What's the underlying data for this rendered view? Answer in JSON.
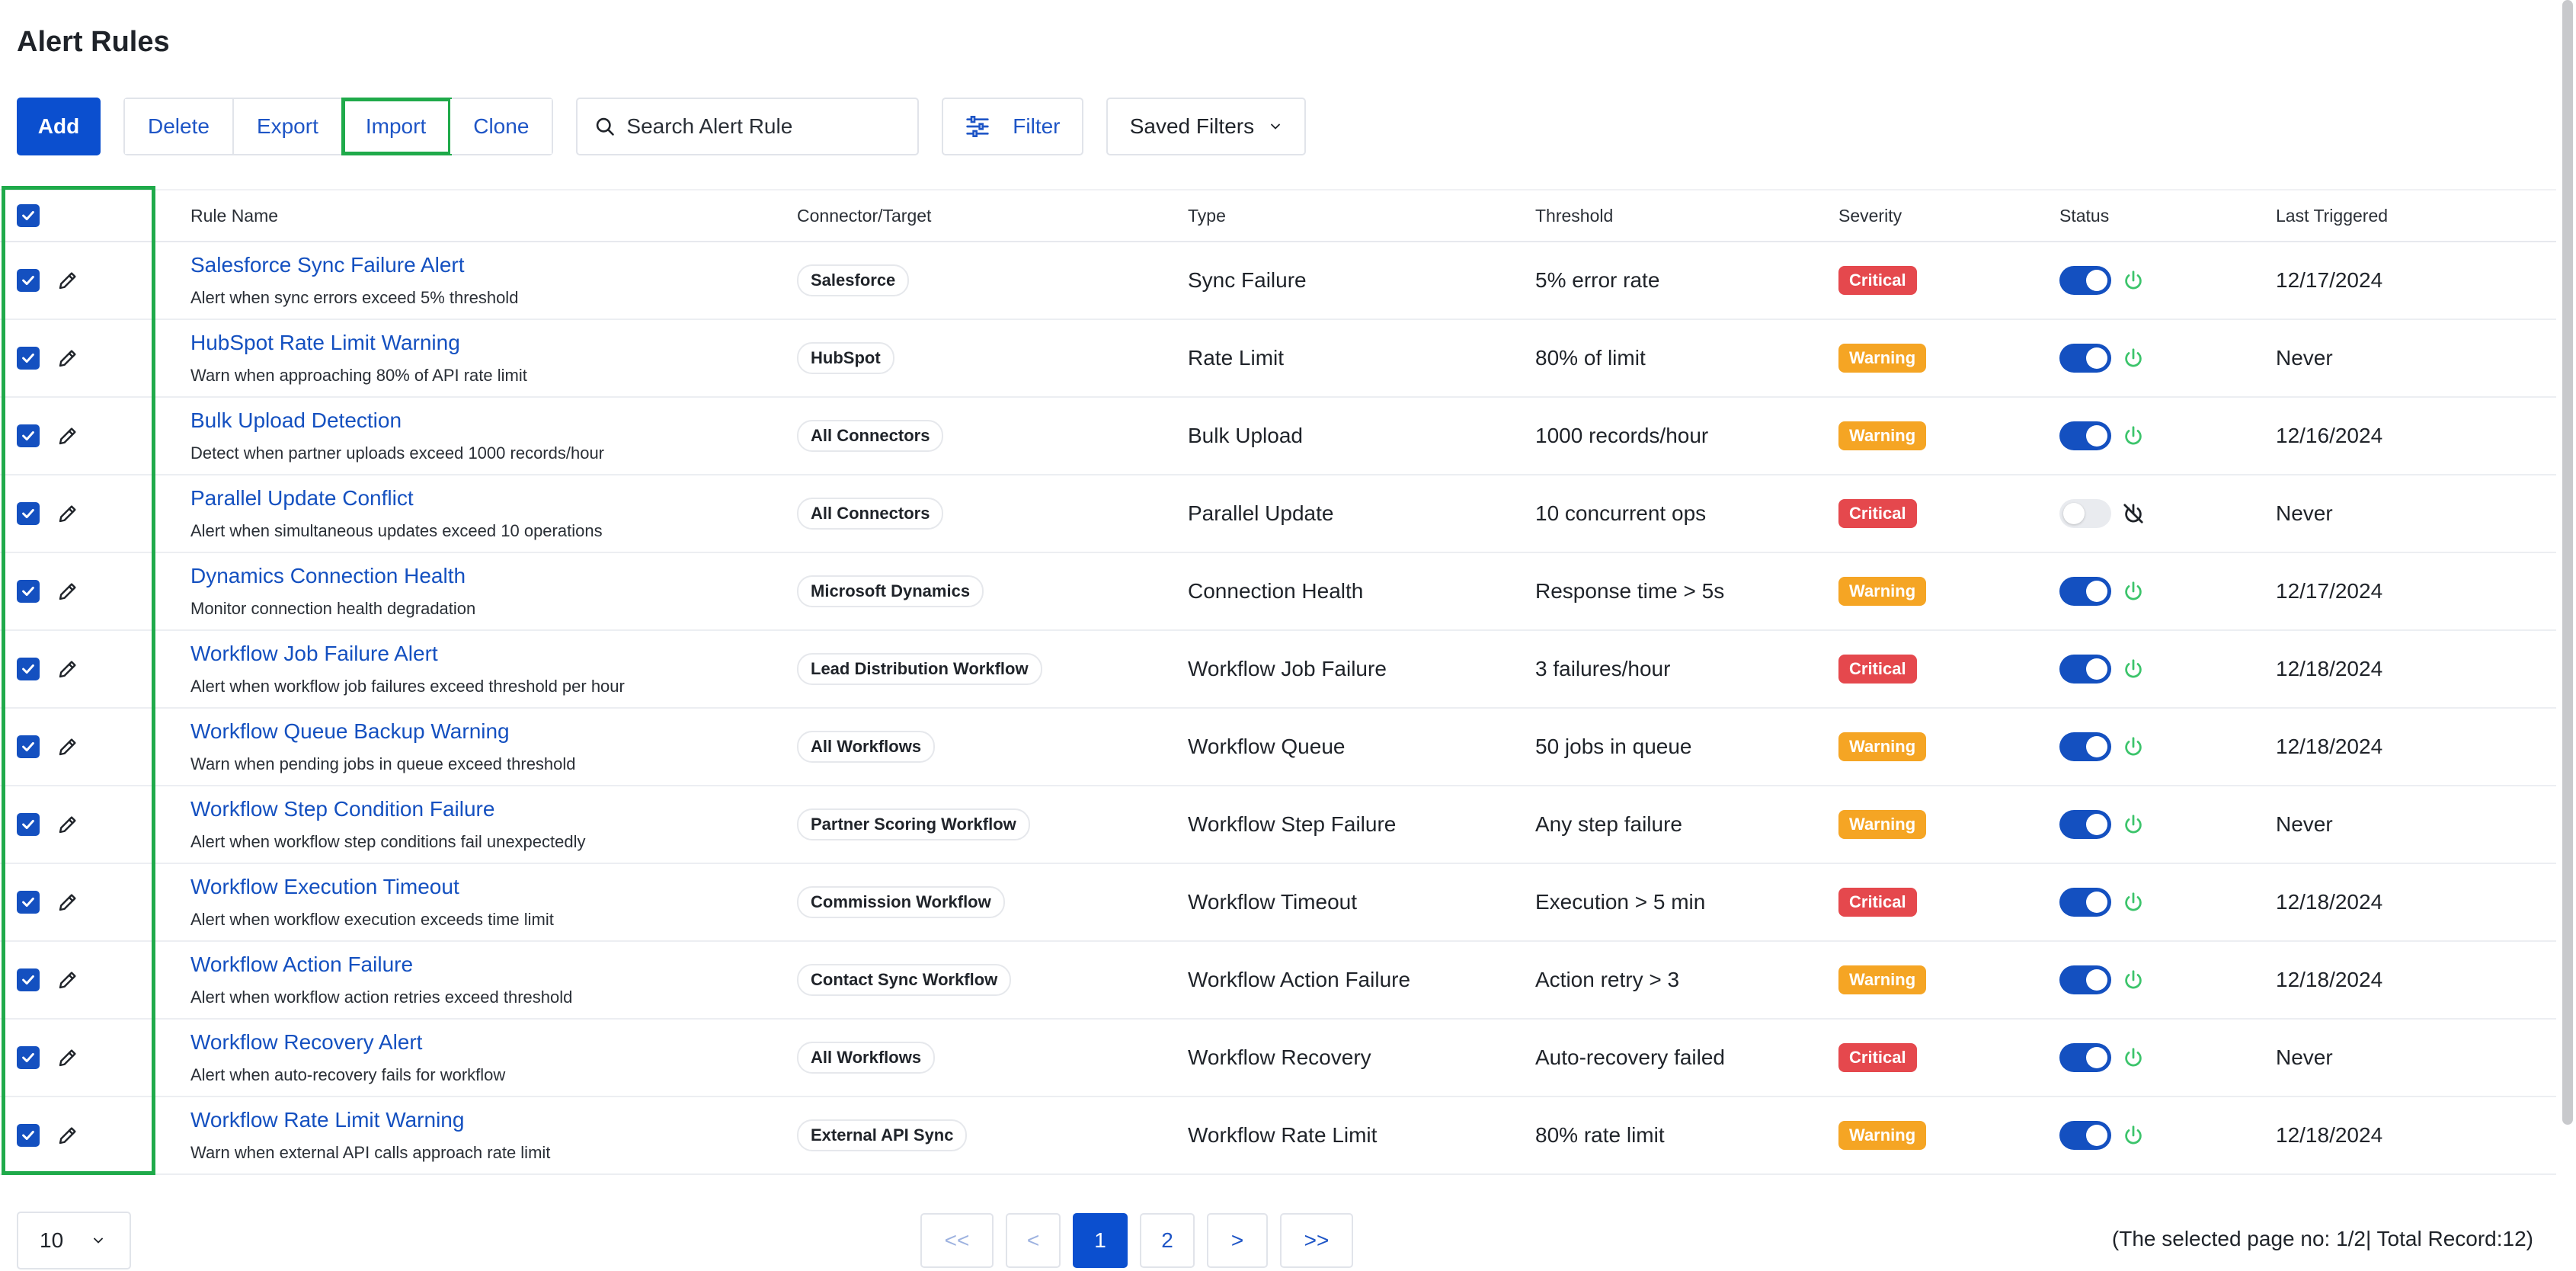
{
  "page": {
    "title": "Alert Rules"
  },
  "toolbar": {
    "add_label": "Add",
    "delete_label": "Delete",
    "export_label": "Export",
    "import_label": "Import",
    "clone_label": "Clone",
    "search_placeholder": "Search Alert Rule",
    "filter_label": "Filter",
    "saved_filters_label": "Saved Filters"
  },
  "columns": {
    "rule_name": "Rule Name",
    "connector": "Connector/Target",
    "type": "Type",
    "threshold": "Threshold",
    "severity": "Severity",
    "status": "Status",
    "last_triggered": "Last Triggered"
  },
  "rows": [
    {
      "name": "Salesforce Sync Failure Alert",
      "desc": "Alert when sync errors exceed 5% threshold",
      "connector": "Salesforce",
      "type": "Sync Failure",
      "threshold": "5% error rate",
      "severity": "Critical",
      "status": "on",
      "last": "12/17/2024"
    },
    {
      "name": "HubSpot Rate Limit Warning",
      "desc": "Warn when approaching 80% of API rate limit",
      "connector": "HubSpot",
      "type": "Rate Limit",
      "threshold": "80% of limit",
      "severity": "Warning",
      "status": "on",
      "last": "Never"
    },
    {
      "name": "Bulk Upload Detection",
      "desc": "Detect when partner uploads exceed 1000 records/hour",
      "connector": "All Connectors",
      "type": "Bulk Upload",
      "threshold": "1000 records/hour",
      "severity": "Warning",
      "status": "on",
      "last": "12/16/2024"
    },
    {
      "name": "Parallel Update Conflict",
      "desc": "Alert when simultaneous updates exceed 10 operations",
      "connector": "All Connectors",
      "type": "Parallel Update",
      "threshold": "10 concurrent ops",
      "severity": "Critical",
      "status": "off",
      "last": "Never"
    },
    {
      "name": "Dynamics Connection Health",
      "desc": "Monitor connection health degradation",
      "connector": "Microsoft Dynamics",
      "type": "Connection Health",
      "threshold": "Response time > 5s",
      "severity": "Warning",
      "status": "on",
      "last": "12/17/2024"
    },
    {
      "name": "Workflow Job Failure Alert",
      "desc": "Alert when workflow job failures exceed threshold per hour",
      "connector": "Lead Distribution Workflow",
      "type": "Workflow Job Failure",
      "threshold": "3 failures/hour",
      "severity": "Critical",
      "status": "on",
      "last": "12/18/2024"
    },
    {
      "name": "Workflow Queue Backup Warning",
      "desc": "Warn when pending jobs in queue exceed threshold",
      "connector": "All Workflows",
      "type": "Workflow Queue",
      "threshold": "50 jobs in queue",
      "severity": "Warning",
      "status": "on",
      "last": "12/18/2024"
    },
    {
      "name": "Workflow Step Condition Failure",
      "desc": "Alert when workflow step conditions fail unexpectedly",
      "connector": "Partner Scoring Workflow",
      "type": "Workflow Step Failure",
      "threshold": "Any step failure",
      "severity": "Warning",
      "status": "on",
      "last": "Never"
    },
    {
      "name": "Workflow Execution Timeout",
      "desc": "Alert when workflow execution exceeds time limit",
      "connector": "Commission Workflow",
      "type": "Workflow Timeout",
      "threshold": "Execution > 5 min",
      "severity": "Critical",
      "status": "on",
      "last": "12/18/2024"
    },
    {
      "name": "Workflow Action Failure",
      "desc": "Alert when workflow action retries exceed threshold",
      "connector": "Contact Sync Workflow",
      "type": "Workflow Action Failure",
      "threshold": "Action retry > 3",
      "severity": "Warning",
      "status": "on",
      "last": "12/18/2024"
    },
    {
      "name": "Workflow Recovery Alert",
      "desc": "Alert when auto-recovery fails for workflow",
      "connector": "All Workflows",
      "type": "Workflow Recovery",
      "threshold": "Auto-recovery failed",
      "severity": "Critical",
      "status": "on",
      "last": "Never"
    },
    {
      "name": "Workflow Rate Limit Warning",
      "desc": "Warn when external API calls approach rate limit",
      "connector": "External API Sync",
      "type": "Workflow Rate Limit",
      "threshold": "80% rate limit",
      "severity": "Warning",
      "status": "on",
      "last": "12/18/2024"
    }
  ],
  "footer": {
    "page_size": "10",
    "first": "<<",
    "prev": "<",
    "page1": "1",
    "page2": "2",
    "next": ">",
    "last": ">>",
    "info": "(The selected page no: 1/2| Total Record:12)"
  },
  "colors": {
    "primary": "#0b4fcf",
    "link": "#1450c0",
    "critical": "#e5484d",
    "warning": "#f5a524",
    "power_on": "#3cc46b",
    "highlight": "#1faa4a"
  },
  "icons": {
    "search": "search-icon",
    "filter": "sliders-icon",
    "chevron": "chevron-down-icon",
    "checkbox": "checkmark-icon",
    "edit": "pencil-icon",
    "power_on": "power-icon",
    "power_off": "power-off-icon"
  }
}
